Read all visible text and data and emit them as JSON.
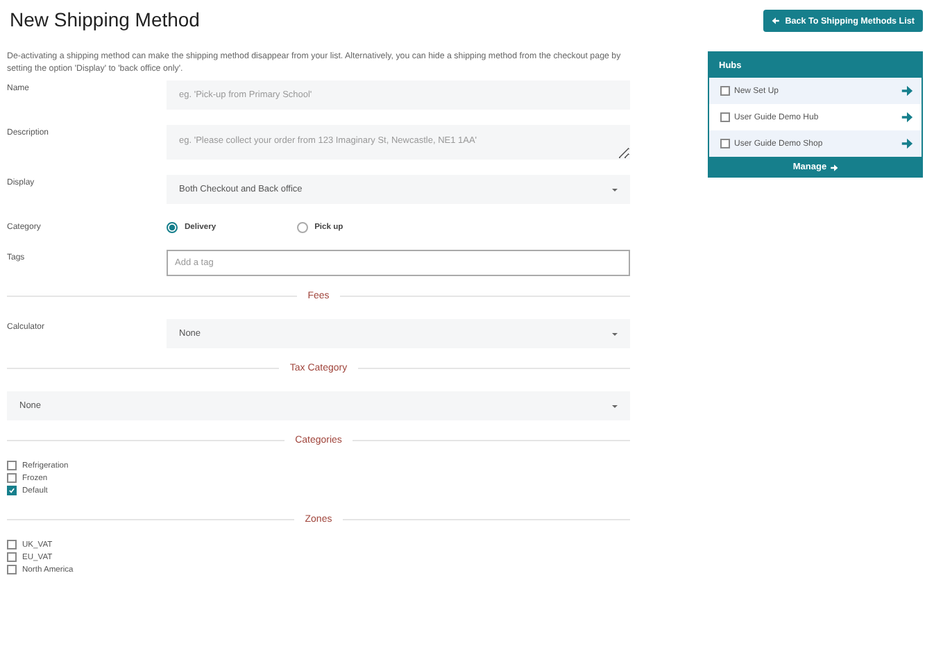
{
  "title": "New Shipping Method",
  "back_button": "Back To Shipping Methods List",
  "intro": "De-activating a shipping method can make the shipping method disappear from your list. Alternatively, you can hide a shipping method from the checkout page by setting the option 'Display' to 'back office only'.",
  "fields": [
    {
      "kind": "text",
      "label": "Name",
      "placeholder": "eg. 'Pick-up from Primary School'"
    },
    {
      "kind": "textarea",
      "label": "Description",
      "placeholder": "eg. 'Please collect your order from 123 Imaginary St, Newcastle, NE1 1AA'"
    },
    {
      "kind": "select",
      "label": "Display",
      "value": "Both Checkout and Back office"
    },
    {
      "kind": "radio",
      "label": "Category",
      "options": [
        {
          "label": "Delivery",
          "selected": true
        },
        {
          "label": "Pick up",
          "selected": false
        }
      ]
    },
    {
      "kind": "tags",
      "label": "Tags",
      "placeholder": "Add a tag"
    }
  ],
  "sections": [
    {
      "heading": "Fees",
      "kind": "fields",
      "fields": [
        {
          "kind": "select",
          "label": "Calculator",
          "value": "None"
        }
      ]
    },
    {
      "heading": "Tax Category",
      "kind": "fields",
      "fields": [
        {
          "kind": "select",
          "value": "None"
        }
      ]
    },
    {
      "heading": "Categories",
      "kind": "checklist",
      "items": [
        {
          "label": "Refrigeration",
          "checked": false
        },
        {
          "label": "Frozen",
          "checked": false
        },
        {
          "label": "Default",
          "checked": true
        }
      ]
    },
    {
      "heading": "Zones",
      "kind": "checklist",
      "items": [
        {
          "label": "UK_VAT",
          "checked": false
        },
        {
          "label": "EU_VAT",
          "checked": false
        },
        {
          "label": "North America",
          "checked": false
        }
      ]
    }
  ],
  "hubs": {
    "title": "Hubs",
    "items": [
      {
        "label": "New Set Up",
        "checked": false
      },
      {
        "label": "User Guide Demo Hub",
        "checked": false
      },
      {
        "label": "User Guide Demo Shop",
        "checked": false
      }
    ],
    "manage": "Manage"
  }
}
